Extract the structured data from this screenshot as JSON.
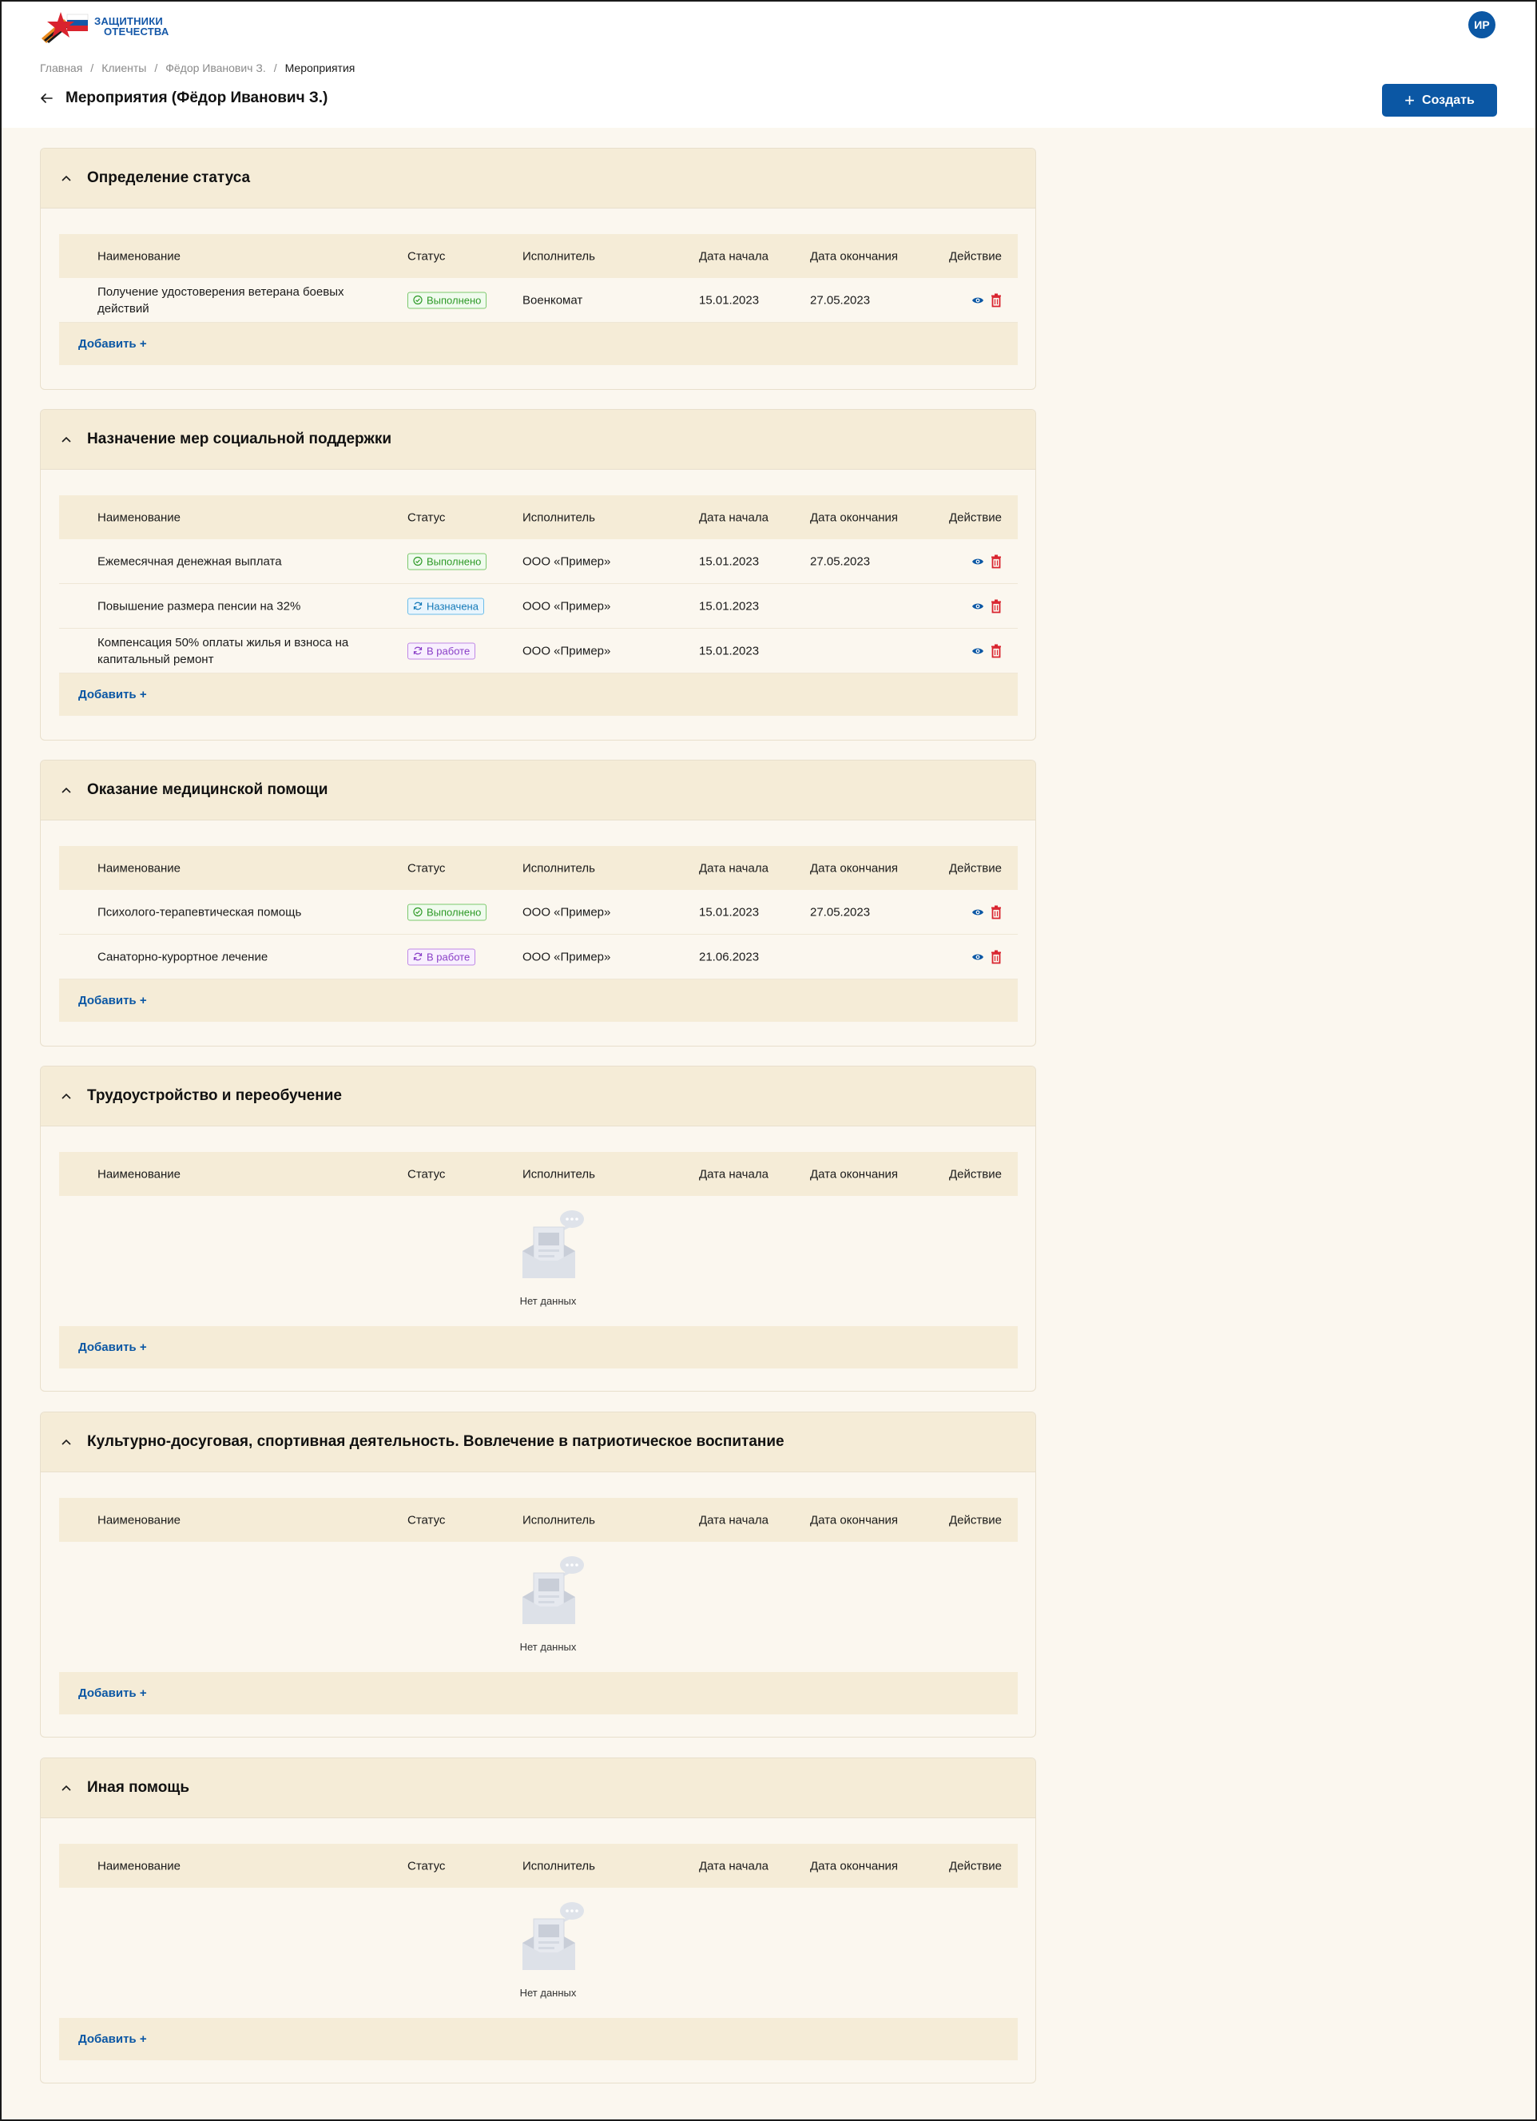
{
  "header": {
    "logo_line1": "ЗАЩИТНИКИ",
    "logo_line2": "ОТЕЧЕСТВА",
    "avatar_initials": "ИР"
  },
  "breadcrumb": [
    "Главная",
    "Клиенты",
    "Фёдор Иванович З.",
    "Мероприятия"
  ],
  "page": {
    "title": "Мероприятия (Фёдор Иванович З.)",
    "create_label": "Создать"
  },
  "table_columns": {
    "name": "Наименование",
    "status": "Статус",
    "executor": "Исполнитель",
    "start": "Дата начала",
    "end": "Дата окончания",
    "action": "Действие"
  },
  "add_label": "Добавить +",
  "empty_label": "Нет данных",
  "colors": {
    "accent": "#0b57a4",
    "delete": "#d9232e",
    "done": "#2e9a27",
    "assigned": "#1379b8",
    "in_work": "#8a3fc7",
    "panel": "#f5ecd7",
    "background": "#fbf7ef"
  },
  "sections": [
    {
      "title": "Определение статуса",
      "rows": [
        {
          "name": "Получение удостоверения ветерана боевых действий",
          "status": "Выполнено",
          "status_type": "done",
          "executor": "Военкомат",
          "start": "15.01.2023",
          "end": "27.05.2023"
        }
      ]
    },
    {
      "title": "Назначение мер социальной поддержки",
      "rows": [
        {
          "name": "Ежемесячная денежная выплата",
          "status": "Выполнено",
          "status_type": "done",
          "executor": "ООО «Пример»",
          "start": "15.01.2023",
          "end": "27.05.2023"
        },
        {
          "name": "Повышение размера пенсии на 32%",
          "status": "Назначена",
          "status_type": "assigned",
          "executor": "ООО «Пример»",
          "start": "15.01.2023",
          "end": ""
        },
        {
          "name": "Компенсация 50% оплаты жилья и взноса на капитальный ремонт",
          "status": "В работе",
          "status_type": "work",
          "executor": "ООО «Пример»",
          "start": "15.01.2023",
          "end": ""
        }
      ]
    },
    {
      "title": "Оказание медицинской помощи",
      "rows": [
        {
          "name": "Психолого-терапевтическая помощь",
          "status": "Выполнено",
          "status_type": "done",
          "executor": "ООО «Пример»",
          "start": "15.01.2023",
          "end": "27.05.2023"
        },
        {
          "name": "Санаторно-курортное лечение",
          "status": "В работе",
          "status_type": "work",
          "executor": "ООО «Пример»",
          "start": "21.06.2023",
          "end": ""
        }
      ]
    },
    {
      "title": "Трудоустройство и переобучение",
      "rows": []
    },
    {
      "title": "Культурно-досуговая, спортивная деятельность. Вовлечение в патриотическое воспитание",
      "rows": []
    },
    {
      "title": "Иная помощь",
      "rows": []
    }
  ]
}
